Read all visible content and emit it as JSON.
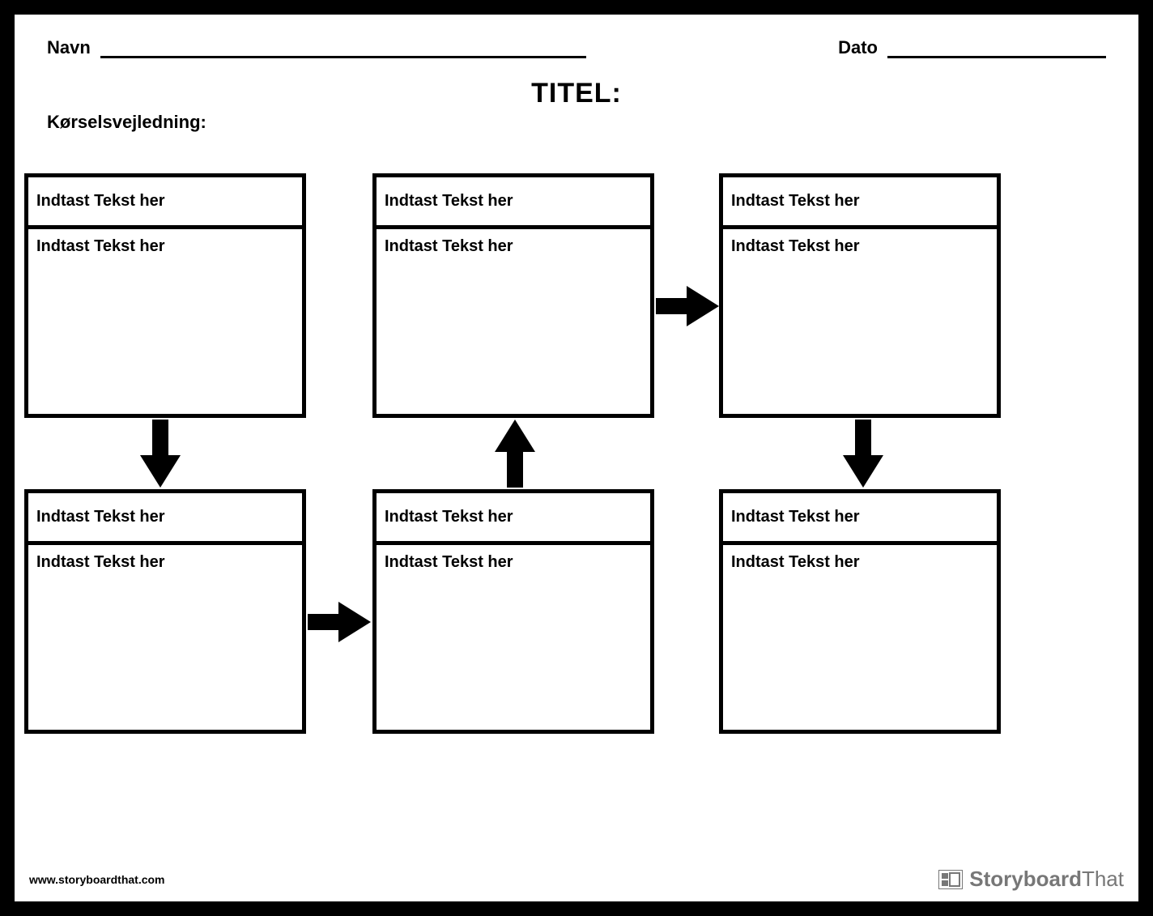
{
  "header": {
    "name_label": "Navn",
    "date_label": "Dato"
  },
  "title": "TITEL:",
  "directions_label": "Kørselsvejledning:",
  "cells": [
    {
      "head": "Indtast Tekst her",
      "body": "Indtast Tekst her"
    },
    {
      "head": "Indtast Tekst her",
      "body": "Indtast Tekst her"
    },
    {
      "head": "Indtast Tekst her",
      "body": "Indtast Tekst her"
    },
    {
      "head": "Indtast Tekst her",
      "body": "Indtast Tekst her"
    },
    {
      "head": "Indtast Tekst her",
      "body": "Indtast Tekst her"
    },
    {
      "head": "Indtast Tekst her",
      "body": "Indtast Tekst her"
    }
  ],
  "footer": {
    "site": "www.storyboardthat.com",
    "brand_a": "Storyboard",
    "brand_b": "That"
  }
}
